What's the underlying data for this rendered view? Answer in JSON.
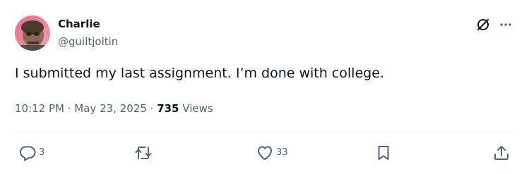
{
  "user": {
    "display_name": "Charlie",
    "handle": "@guiltjoltin"
  },
  "tweet": {
    "text": "I submitted my last assignment. I’m done with college.",
    "time": "10:12 PM",
    "date": "May 23, 2025",
    "views_count": "735",
    "views_label": "Views"
  },
  "actions": {
    "reply_count": "3",
    "like_count": "33"
  },
  "icons": {
    "grok": "grok-icon",
    "more": "more-icon",
    "reply": "reply-icon",
    "retweet": "retweet-icon",
    "like": "heart-icon",
    "bookmark": "bookmark-icon",
    "share": "share-icon"
  },
  "colors": {
    "text_primary": "#0f1419",
    "text_secondary": "#536471",
    "divider": "#eff3f4"
  }
}
